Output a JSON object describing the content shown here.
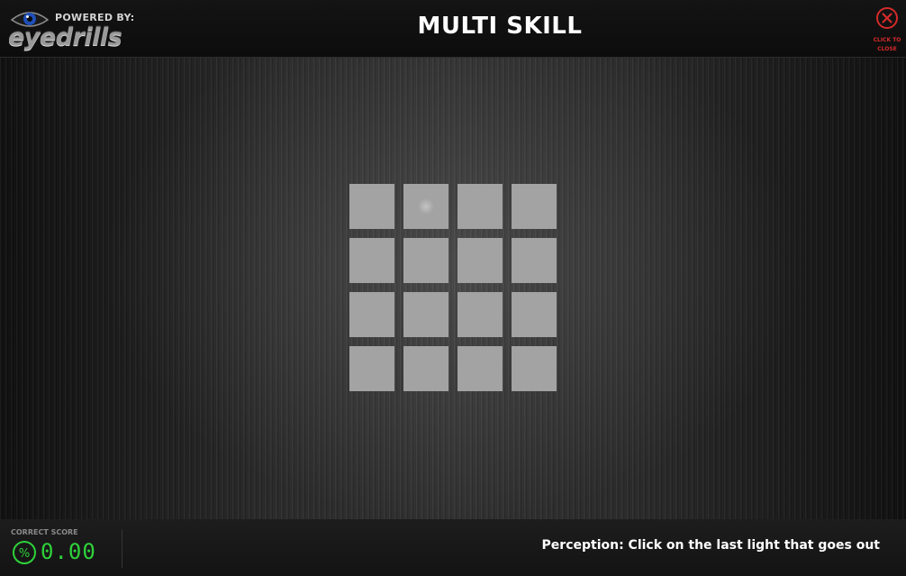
{
  "header": {
    "powered_by": "POWERED BY:",
    "brand": "eyedrills",
    "title": "MULTI SKILL",
    "close_label": "CLICK TO CLOSE",
    "close_icon": "close-icon",
    "accent_color": "#d42a2a"
  },
  "game": {
    "grid_rows": 4,
    "grid_cols": 4,
    "cell_color": "#a3a3a3",
    "highlighted_cell": [
      0,
      1
    ]
  },
  "footer": {
    "score_label": "CORRECT SCORE",
    "score_icon": "percent-icon",
    "score_symbol": "%",
    "score_value": "0.00",
    "score_color": "#2ed13a",
    "instruction": "Perception: Click on the last light that goes out"
  }
}
